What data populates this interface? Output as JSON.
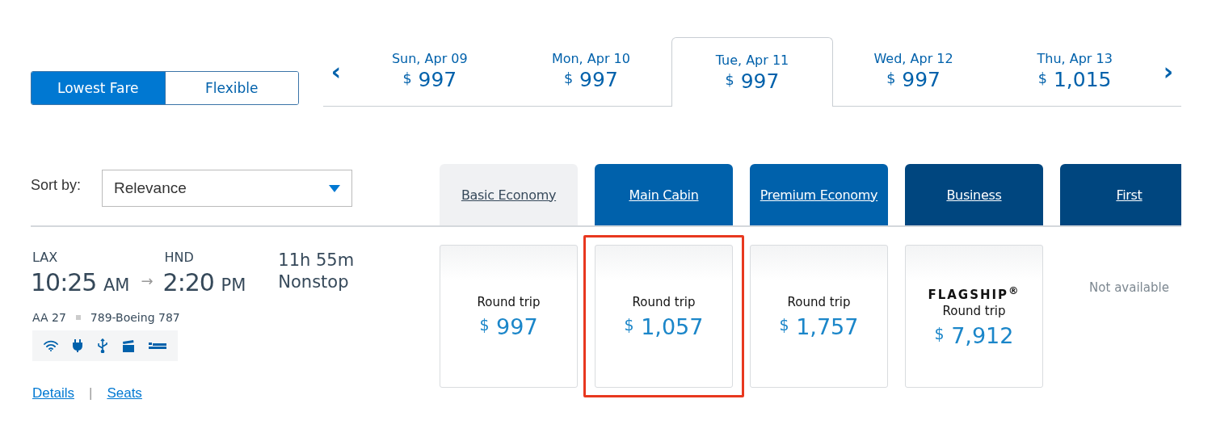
{
  "fare_toggle": [
    {
      "label": "Lowest Fare",
      "selected": true
    },
    {
      "label": "Flexible",
      "selected": false
    }
  ],
  "date_nav": {
    "prev": "‹",
    "next": "›"
  },
  "dates": [
    {
      "date": "Sun, Apr 09",
      "currency": "$",
      "amount": "997",
      "selected": false
    },
    {
      "date": "Mon, Apr 10",
      "currency": "$",
      "amount": "997",
      "selected": false
    },
    {
      "date": "Tue, Apr 11",
      "currency": "$",
      "amount": "997",
      "selected": true
    },
    {
      "date": "Wed, Apr 12",
      "currency": "$",
      "amount": "997",
      "selected": false
    },
    {
      "date": "Thu, Apr 13",
      "currency": "$",
      "amount": "1,015",
      "selected": false
    }
  ],
  "sort": {
    "label": "Sort by:",
    "value": "Relevance"
  },
  "cabins": [
    {
      "label": "Basic Economy",
      "color": "#f0f1f3"
    },
    {
      "label": "Main Cabin",
      "color": "#0061ab"
    },
    {
      "label": "Premium Economy",
      "color": "#0061ab"
    },
    {
      "label": "Business",
      "color": "#00467f"
    },
    {
      "label": "First",
      "color": "#00467f"
    }
  ],
  "flight": {
    "origin": "LAX",
    "departure": "10:25",
    "departure_period": "AM",
    "arrow": "→",
    "destination": "HND",
    "arrival": "2:20",
    "arrival_period": "PM",
    "duration": "11h  55m",
    "stops": "Nonstop",
    "flight_number": "AA 27",
    "aircraft": "789-Boeing 787",
    "links": [
      "Details",
      "Seats"
    ],
    "link_separator": "|"
  },
  "fares": [
    {
      "kind": "price",
      "label": "Round trip",
      "currency": "$",
      "amount": "997",
      "highlighted": false
    },
    {
      "kind": "price",
      "label": "Round trip",
      "currency": "$",
      "amount": "1,057",
      "highlighted": true
    },
    {
      "kind": "price",
      "label": "Round trip",
      "currency": "$",
      "amount": "1,757",
      "highlighted": false
    },
    {
      "kind": "price",
      "brand": "FLAGSHIP$^{®}$",
      "label": "Round trip",
      "currency": "$",
      "amount": "7,912",
      "highlighted": false
    },
    {
      "kind": "unavailable",
      "label": "Not available"
    }
  ]
}
